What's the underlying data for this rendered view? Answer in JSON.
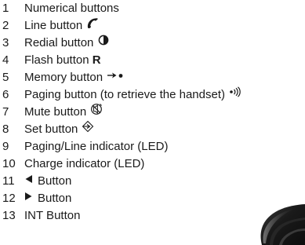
{
  "items": [
    {
      "num": "1",
      "label": "Numerical buttons"
    },
    {
      "num": "2",
      "label": "Line button",
      "icon": "handset-icon"
    },
    {
      "num": "3",
      "label": "Redial button",
      "icon": "half-circle-icon"
    },
    {
      "num": "4",
      "label": "Flash button",
      "key": "R"
    },
    {
      "num": "5",
      "label": "Memory button",
      "icon": "memory-arrow-icon"
    },
    {
      "num": "6",
      "label": "Paging button (to retrieve the handset)",
      "icon": "paging-icon"
    },
    {
      "num": "7",
      "label": "Mute button",
      "icon": "mute-icon"
    },
    {
      "num": "8",
      "label": "Set button",
      "icon": "set-icon"
    },
    {
      "num": "9",
      "label": "Paging/Line indicator (LED)"
    },
    {
      "num": "10",
      "label": "Charge indicator (LED)"
    },
    {
      "num": "11",
      "label": "Button",
      "icon": "left-triangle-icon"
    },
    {
      "num": "12",
      "label": "Button",
      "icon": "right-triangle-icon"
    },
    {
      "num": "13",
      "label": "INT Button"
    }
  ]
}
